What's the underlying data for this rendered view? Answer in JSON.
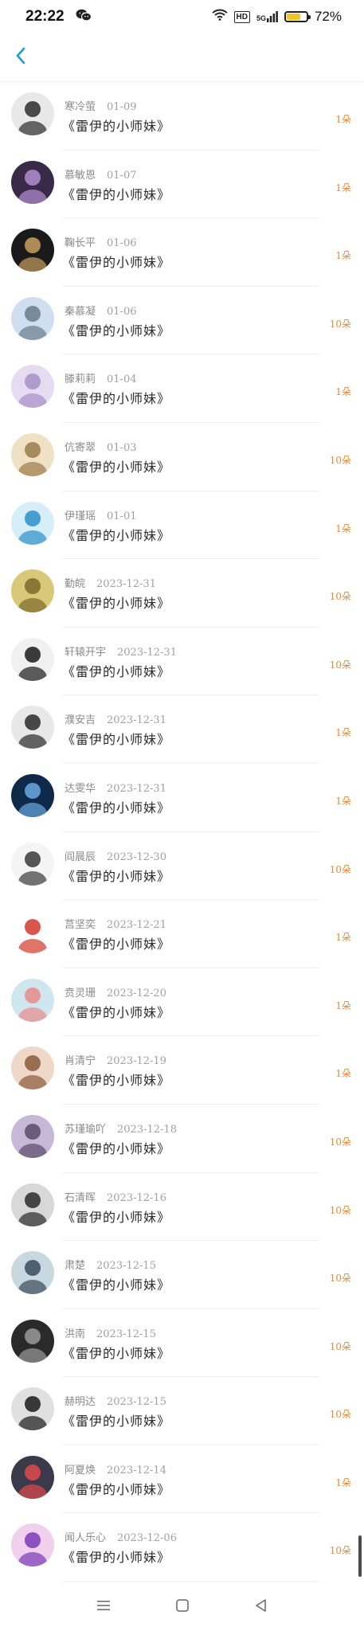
{
  "status_bar": {
    "time": "22:22",
    "hd_badge": "HD",
    "signal_label": "5G",
    "battery_percent": "72%",
    "battery_level": 0.72,
    "battery_color": "#f1c232",
    "icons": [
      "wechat-icon",
      "wifi-icon",
      "signal-icon",
      "battery-icon"
    ]
  },
  "nav": {
    "back_icon": "chevron-left-icon",
    "accent": "#1a9be0"
  },
  "records": [
    {
      "name": "寒冷萤",
      "date": "01-09",
      "book": "《雷伊的小师妹》",
      "count": "1朵"
    },
    {
      "name": "慕敏恩",
      "date": "01-07",
      "book": "《雷伊的小师妹》",
      "count": "1朵"
    },
    {
      "name": "鞠长平",
      "date": "01-06",
      "book": "《雷伊的小师妹》",
      "count": "1朵"
    },
    {
      "name": "秦慕凝",
      "date": "01-06",
      "book": "《雷伊的小师妹》",
      "count": "10朵"
    },
    {
      "name": "滕莉莉",
      "date": "01-04",
      "book": "《雷伊的小师妹》",
      "count": "1朵"
    },
    {
      "name": "伉寄翠",
      "date": "01-03",
      "book": "《雷伊的小师妹》",
      "count": "10朵"
    },
    {
      "name": "伊瑾瑶",
      "date": "01-01",
      "book": "《雷伊的小师妹》",
      "count": "1朵"
    },
    {
      "name": "勤皖",
      "date": "2023-12-31",
      "book": "《雷伊的小师妹》",
      "count": "10朵"
    },
    {
      "name": "轩辕开宇",
      "date": "2023-12-31",
      "book": "《雷伊的小师妹》",
      "count": "10朵"
    },
    {
      "name": "濮安吉",
      "date": "2023-12-31",
      "book": "《雷伊的小师妹》",
      "count": "1朵"
    },
    {
      "name": "达雯华",
      "date": "2023-12-31",
      "book": "《雷伊的小师妹》",
      "count": "1朵"
    },
    {
      "name": "阎晨辰",
      "date": "2023-12-30",
      "book": "《雷伊的小师妹》",
      "count": "10朵"
    },
    {
      "name": "莒坚奕",
      "date": "2023-12-21",
      "book": "《雷伊的小师妹》",
      "count": "1朵"
    },
    {
      "name": "贲灵珊",
      "date": "2023-12-20",
      "book": "《雷伊的小师妹》",
      "count": "1朵"
    },
    {
      "name": "肖清宁",
      "date": "2023-12-19",
      "book": "《雷伊的小师妹》",
      "count": "1朵"
    },
    {
      "name": "苏瑾瑜吖",
      "date": "2023-12-18",
      "book": "《雷伊的小师妹》",
      "count": "10朵"
    },
    {
      "name": "石清晖",
      "date": "2023-12-16",
      "book": "《雷伊的小师妹》",
      "count": "10朵"
    },
    {
      "name": "肃楚",
      "date": "2023-12-15",
      "book": "《雷伊的小师妹》",
      "count": "10朵"
    },
    {
      "name": "洪南",
      "date": "2023-12-15",
      "book": "《雷伊的小师妹》",
      "count": "10朵"
    },
    {
      "name": "赫明达",
      "date": "2023-12-15",
      "book": "《雷伊的小师妹》",
      "count": "10朵"
    },
    {
      "name": "阿夏焕",
      "date": "2023-12-14",
      "book": "《雷伊的小师妹》",
      "count": "1朵"
    },
    {
      "name": "闻人乐心",
      "date": "2023-12-06",
      "book": "《雷伊的小师妹》",
      "count": "10朵"
    }
  ],
  "avatar_colors": [
    [
      "#e8e8e8",
      "#2b2b2b"
    ],
    [
      "#3a2a4a",
      "#b38fd0"
    ],
    [
      "#1a1a1a",
      "#c8a060"
    ],
    [
      "#cfdff0",
      "#6a7b8c"
    ],
    [
      "#e6dcf2",
      "#a58fc8"
    ],
    [
      "#efe2c4",
      "#9b7b4a"
    ],
    [
      "#d6eef8",
      "#2a8fc8"
    ],
    [
      "#d8c878",
      "#7a6a2a"
    ],
    [
      "#f0f0f0",
      "#1a1a1a"
    ],
    [
      "#e8e8e8",
      "#2a2a2a"
    ],
    [
      "#0f2a48",
      "#6aa8e0"
    ],
    [
      "#f4f4f4",
      "#3a3a3a"
    ],
    [
      "#ffffff",
      "#d23a2a"
    ],
    [
      "#cfe6ee",
      "#e88a8a"
    ],
    [
      "#f0d8c8",
      "#8a5a3a"
    ],
    [
      "#c8b8d8",
      "#5a4a6a"
    ],
    [
      "#d8d8d8",
      "#2a2a2a"
    ],
    [
      "#c8d8e0",
      "#3a4a5a"
    ],
    [
      "#2a2a2a",
      "#9a9a9a"
    ],
    [
      "#e0e0e0",
      "#1a1a1a"
    ],
    [
      "#3a3a4a",
      "#e04a4a"
    ],
    [
      "#f0d0ec",
      "#7a3ab8"
    ]
  ],
  "count_color": "#e08a3c",
  "bottom_nav": {
    "icons": [
      "menu-icon",
      "home-square-icon",
      "back-triangle-icon"
    ]
  }
}
